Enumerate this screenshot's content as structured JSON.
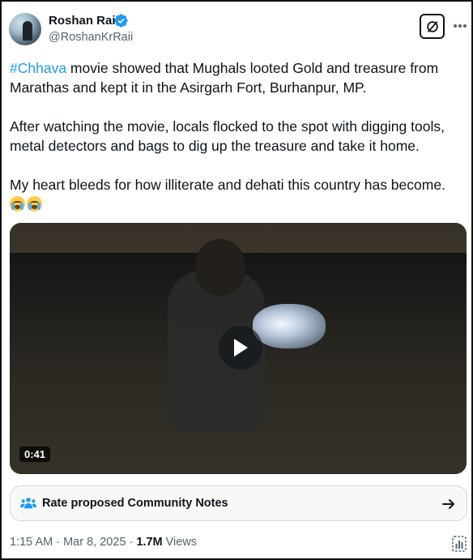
{
  "author": {
    "name": "Roshan Rai",
    "handle": "@RoshanKrRaii",
    "verified": true
  },
  "tweet": {
    "hashtag": "#Chhava",
    "line1_rest": " movie showed that Mughals looted Gold and treasure from Marathas and kept it in the Asirgarh Fort, Burhanpur, MP.",
    "paragraph2": "After watching the movie, locals flocked to the spot with digging tools, metal detectors and bags to dig up the treasure and take it home.",
    "paragraph3": "My heart bleeds for how illiterate and dehati this country has become.",
    "emojis": [
      "loudly-crying-face-icon",
      "loudly-crying-face-icon"
    ]
  },
  "media": {
    "duration": "0:41"
  },
  "community_notes": {
    "label": "Rate proposed Community Notes"
  },
  "meta": {
    "timestamp": "1:15 AM · Mar 8, 2025 · ",
    "views_count": "1.7M",
    "views_label": " Views"
  },
  "colors": {
    "accent": "#1d9bf0",
    "text": "#0f1419",
    "secondary": "#536471"
  },
  "icons": {
    "grok": "grok-icon",
    "more": "more-icon",
    "verified": "verified-badge-icon",
    "play": "play-icon",
    "notes": "community-notes-icon",
    "arrow": "arrow-right-icon",
    "analytics": "analytics-icon"
  }
}
